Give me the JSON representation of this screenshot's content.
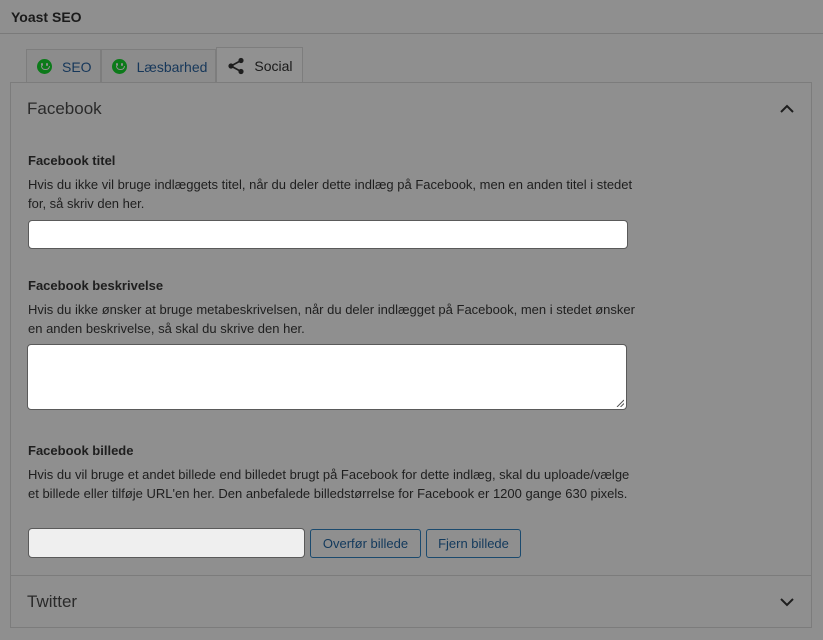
{
  "metabox": {
    "title": "Yoast SEO"
  },
  "tabs": [
    {
      "label": "SEO",
      "icon": "smiley-icon"
    },
    {
      "label": "Læsbarhed",
      "icon": "smiley-icon"
    },
    {
      "label": "Social",
      "icon": "share-icon"
    }
  ],
  "colors": {
    "smiley": "#0c7a1a",
    "link": "#16375a"
  },
  "facebook": {
    "section_title": "Facebook",
    "title_label": "Facebook titel",
    "title_desc": "Hvis du ikke vil bruge indlæggets titel, når du deler dette indlæg på Facebook, men en anden titel i stedet for, så skriv den her.",
    "title_value": "",
    "desc_label": "Facebook beskrivelse",
    "desc_desc": "Hvis du ikke ønsker at bruge metabeskrivelsen, når du deler indlægget på Facebook, men i stedet ønsker en anden beskrivelse, så skal du skrive den her.",
    "desc_value": "",
    "image_label": "Facebook billede",
    "image_desc": "Hvis du vil bruge et andet billede end billedet brugt på Facebook for dette indlæg, skal du uploade/vælge et billede eller tilføje URL'en her. Den anbefalede billedstørrelse for Facebook er 1200 gange 630 pixels.",
    "image_value": "",
    "upload_button": "Overfør billede",
    "remove_button": "Fjern billede"
  },
  "twitter": {
    "section_title": "Twitter"
  }
}
